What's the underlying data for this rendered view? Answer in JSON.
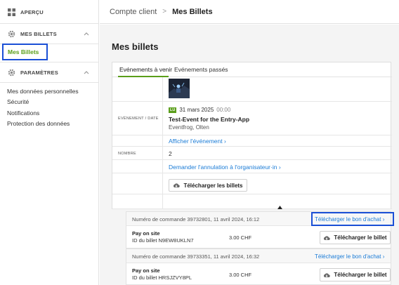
{
  "sidebar": {
    "overview_label": "APERÇU",
    "tickets_section_label": "MES BILLETS",
    "tickets_item_label": "Mes Billets",
    "settings_section_label": "PARAMÈTRES",
    "settings_items": [
      {
        "label": "Mes données personnelles"
      },
      {
        "label": "Sécurité"
      },
      {
        "label": "Notifications"
      },
      {
        "label": "Protection des données"
      }
    ]
  },
  "breadcrumb": {
    "parent": "Compte client",
    "separator": ">",
    "current": "Mes Billets"
  },
  "page": {
    "title": "Mes billets"
  },
  "tabs": [
    {
      "label": "Evénements à venir",
      "active": true
    },
    {
      "label": "Evénements passés",
      "active": false
    }
  ],
  "event": {
    "date_label": "EVÉNEMENT / DATE",
    "day_badge": "LU",
    "date": "31 mars 2025",
    "time": "00:00",
    "title": "Test-Event for the Entry-App",
    "location": "Eventfrog, Olten",
    "view_link": "Afficher l'événement",
    "count_label": "NOMBRE",
    "count": "2",
    "cancel_link": "Demander l'annulation à l'organisateur·in",
    "download_tickets_label": "Télécharger les billets"
  },
  "orders": [
    {
      "order_text": "Numéro de commande 39732801, 11 avril 2024, 16:12",
      "voucher_link": "Télécharger le bon d'achat",
      "payment": "Pay on site",
      "ticket_id": "ID du billet N9EW8UKLN7",
      "price": "3.00 CHF",
      "download_label": "Télécharger le billet"
    },
    {
      "order_text": "Numéro de commande 39733351, 11 avril 2024, 16:32",
      "voucher_link": "Télécharger le bon d'achat",
      "payment": "Pay on site",
      "ticket_id": "ID du billet HRSJZVY8PL",
      "price": "3.00 CHF",
      "download_label": "Télécharger le billet"
    }
  ],
  "colors": {
    "accent_green": "#5a9e1a",
    "link_blue": "#1a7bd6",
    "highlight_blue": "#1a4fd6"
  },
  "icons": {
    "overview": "grid-icon",
    "tickets": "gear-icon",
    "settings": "gear-icon",
    "section_toggle": "chevron-up-icon",
    "collapse": "triangle-up-icon",
    "download": "cloud-download-icon"
  }
}
